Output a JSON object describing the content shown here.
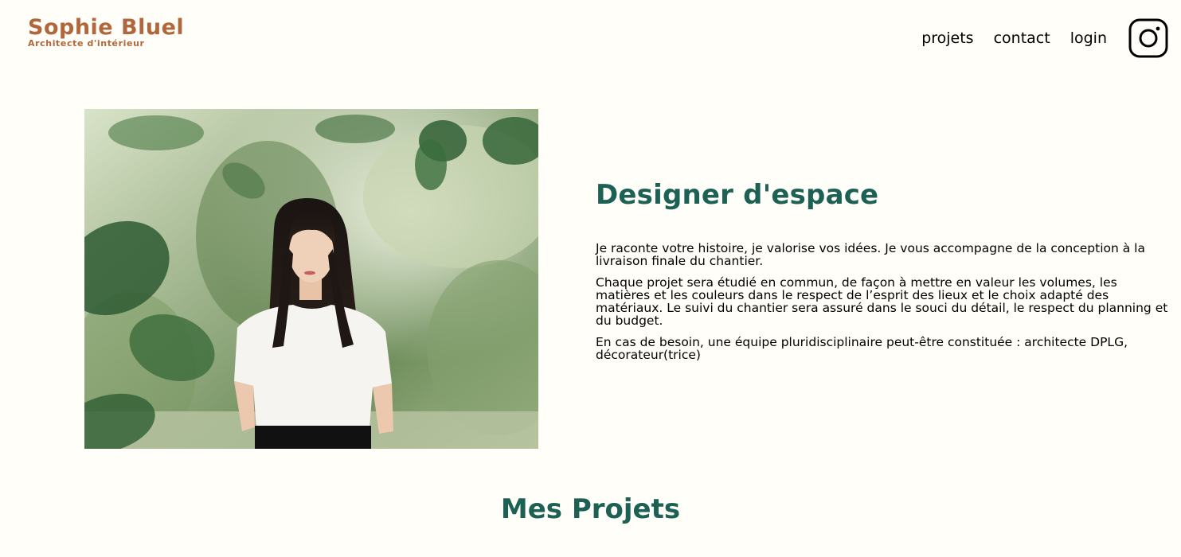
{
  "header": {
    "logo_name": "Sophie Bluel",
    "logo_subtitle": "Architecte d'intérieur",
    "nav": [
      {
        "label": "projets"
      },
      {
        "label": "contact"
      },
      {
        "label": "login"
      }
    ],
    "social_icon": "instagram-icon"
  },
  "intro": {
    "title": "Designer d'espace",
    "paragraphs": [
      "Je raconte votre histoire, je valorise vos idées. Je vous accompagne de la conception à la livraison finale du chantier.",
      "Chaque projet sera étudié en commun, de façon à mettre en valeur les volumes, les matières et les couleurs dans le respect de l’esprit des lieux et le choix adapté des matériaux. Le suivi du chantier sera assuré dans le souci du détail, le respect du planning et du budget.",
      "En cas de besoin, une équipe pluridisciplinaire peut-être constituée : architecte DPLG, décorateur(trice)"
    ]
  },
  "projects": {
    "title": "Mes Projets"
  },
  "colors": {
    "background": "#FFFEF8",
    "brand": "#B1663C",
    "accent": "#1D6154"
  }
}
